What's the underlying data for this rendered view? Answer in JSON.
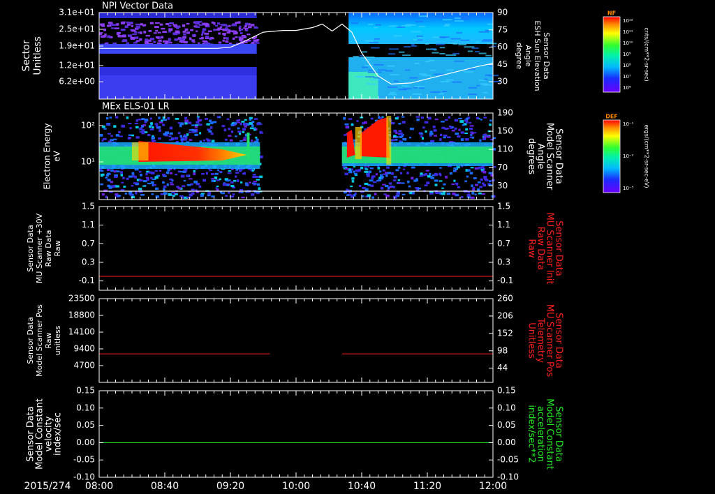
{
  "date_label": "2015/274",
  "time_ticks": [
    "08:00",
    "08:40",
    "09:20",
    "10:00",
    "10:40",
    "11:20",
    "12:00"
  ],
  "colors": {
    "background": "#000000",
    "axes": "#ffffff",
    "panel3_right_label": "#ff2020",
    "panel4_right_label": "#ff2020",
    "panel5_right_label": "#22ee22",
    "trace_red": "#ff2020",
    "trace_green": "#22ee22"
  },
  "colorbars": [
    {
      "title": "NF",
      "units": "cnts/(cm**2-sr-sec)",
      "ticks": [
        "10¹²",
        "10¹¹",
        "10¹⁰",
        "10⁹",
        "10⁸",
        "10⁷",
        "10⁶"
      ]
    },
    {
      "title": "DEF",
      "units": "ergs/(cm**2-sr-sec-eV)",
      "ticks": [
        "10⁻¹",
        "10⁻²",
        "10⁻³"
      ]
    }
  ],
  "chart_data": [
    {
      "type": "heatmap",
      "title": "NPI Vector Data",
      "ylabel": "Sector Unitless",
      "yticks": [
        "3.1e+01",
        "2.5e+01",
        "1.9e+01",
        "1.2e+01",
        "6.2e+00"
      ],
      "ylim": [
        0,
        31
      ],
      "data_gap_x": [
        "09:36",
        "10:32"
      ],
      "right_axis": {
        "label": [
          "Sensor Data",
          "ESH Sun Elevation",
          "Angle",
          "degree"
        ],
        "ticks": [
          "90",
          "75",
          "60",
          "45",
          "30"
        ],
        "ylim": [
          15,
          90
        ]
      },
      "overlay_series": {
        "x": [
          "08:00",
          "08:50",
          "09:12",
          "09:20",
          "09:27",
          "09:40",
          "09:52",
          "10:00",
          "10:10",
          "10:16",
          "10:22",
          "10:28",
          "10:34",
          "10:40",
          "10:50",
          "10:58",
          "11:10",
          "11:30",
          "11:50",
          "12:00"
        ],
        "y": [
          59,
          59,
          59,
          60,
          64,
          73,
          74.5,
          74.5,
          77,
          80,
          74,
          80,
          73,
          55,
          35,
          28,
          29,
          36,
          43,
          46
        ]
      }
    },
    {
      "type": "heatmap",
      "title": "MEx ELS-01 LR",
      "ylabel": "Electron Energy eV",
      "yscale": "log",
      "yticks": [
        "10²",
        "10¹"
      ],
      "ylim": [
        1,
        200
      ],
      "data_gap_x": [
        "09:38",
        "10:28"
      ],
      "right_axis": {
        "label": [
          "Sensor Data",
          "Model Scanner",
          "Angle",
          "degrees"
        ],
        "ticks": [
          "190",
          "150",
          "110",
          "70",
          "30"
        ],
        "ylim": [
          0,
          190
        ]
      }
    },
    {
      "type": "line",
      "ylabel": [
        "Sensor Data",
        "MU Scanner +30V",
        "Raw Data",
        "Raw"
      ],
      "yticks": [
        "1.5",
        "1.1",
        "0.7",
        "0.3",
        "-0.1"
      ],
      "ylim": [
        -0.3,
        1.5
      ],
      "right_axis": {
        "label": [
          "Sensor Data",
          "MU Scanner Init",
          "Raw Data",
          "Raw"
        ],
        "ticks": [
          "1.5",
          "1.1",
          "0.7",
          "0.3",
          "-0.1"
        ],
        "ylim": [
          -0.3,
          1.5
        ]
      },
      "series": [
        {
          "x": [
            "08:00",
            "12:00"
          ],
          "y": [
            0.0,
            0.0
          ]
        }
      ]
    },
    {
      "type": "line",
      "ylabel": [
        "Sensor Data",
        "Model Scanner Pos",
        "Raw",
        "unitless"
      ],
      "yticks": [
        "23500",
        "18800",
        "14100",
        "9400",
        "4700"
      ],
      "ylim": [
        0,
        23500
      ],
      "right_axis": {
        "label": [
          "Sensor Data",
          "MU Scanner Pos",
          "Telemetry",
          "Unitless"
        ],
        "ticks": [
          "260",
          "206",
          "152",
          "98",
          "44"
        ],
        "ylim": [
          0,
          260
        ]
      },
      "series": [
        {
          "x": [
            "08:00",
            "09:44"
          ],
          "y": [
            8000,
            8000
          ]
        },
        {
          "x": [
            "10:28",
            "12:00"
          ],
          "y": [
            8000,
            8000
          ]
        }
      ]
    },
    {
      "type": "line",
      "ylabel": [
        "Sensor Data",
        "Model Constant",
        "velocity",
        "index/sec"
      ],
      "yticks": [
        "0.15",
        "0.10",
        "0.05",
        "0.00",
        "-0.05",
        "-0.10"
      ],
      "ylim": [
        -0.1,
        0.15
      ],
      "right_axis": {
        "label": [
          "Sensor Data",
          "Model Constant",
          "acceleration",
          "index/sec**2"
        ],
        "ticks": [
          "0.15",
          "0.10",
          "0.05",
          "0.00",
          "-0.05",
          "-0.10"
        ],
        "ylim": [
          -0.1,
          0.15
        ]
      },
      "series": [
        {
          "x": [
            "08:00",
            "12:00"
          ],
          "y": [
            0.0,
            0.0
          ]
        }
      ]
    }
  ]
}
